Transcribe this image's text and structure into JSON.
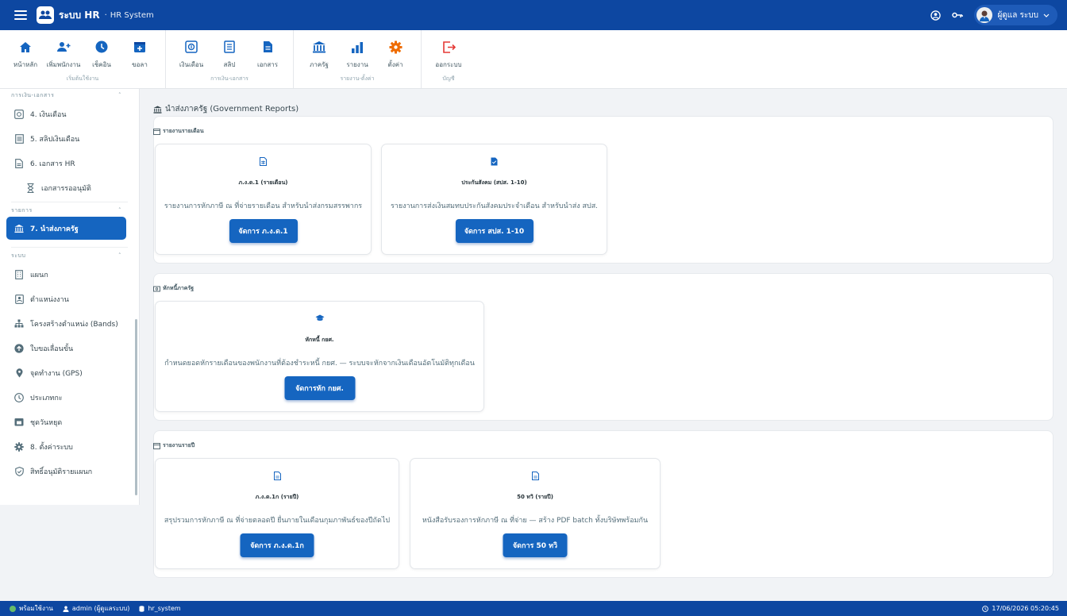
{
  "app": {
    "name": "ระบบ HR",
    "separator": "·",
    "subtitle": "HR System"
  },
  "user": {
    "name": "ผู้ดูแล ระบบ"
  },
  "ribbon": {
    "groups": [
      {
        "label": "เริ่มต้นใช้งาน",
        "buttons": [
          {
            "label": "หน้าหลัก",
            "icon": "home-icon"
          },
          {
            "label": "เพิ่มพนักงาน",
            "icon": "add-user-icon"
          },
          {
            "label": "เช็คอิน",
            "icon": "clock-icon"
          },
          {
            "label": "ขอลา",
            "icon": "calendar-plus-icon"
          }
        ]
      },
      {
        "label": "การเงิน-เอกสาร",
        "buttons": [
          {
            "label": "เงินเดือน",
            "icon": "salary-icon"
          },
          {
            "label": "สลิป",
            "icon": "slip-icon"
          },
          {
            "label": "เอกสาร",
            "icon": "document-icon"
          }
        ]
      },
      {
        "label": "รายงาน-ตั้งค่า",
        "buttons": [
          {
            "label": "ภาครัฐ",
            "icon": "government-icon"
          },
          {
            "label": "รายงาน",
            "icon": "bar-chart-icon"
          },
          {
            "label": "ตั้งค่า",
            "icon": "gear-icon"
          }
        ]
      },
      {
        "label": "บัญชี",
        "buttons": [
          {
            "label": "ออกระบบ",
            "icon": "logout-icon"
          }
        ]
      }
    ]
  },
  "sidebar": {
    "sections": {
      "finance": "การเงิน-เอกสาร",
      "reports": "รายการ",
      "system": "ระบบ"
    },
    "items": [
      {
        "label": "4. เงินเดือน",
        "icon": "salary-icon"
      },
      {
        "label": "5. สลิปเงินเดือน",
        "icon": "slip-icon"
      },
      {
        "label": "6. เอกสาร HR",
        "icon": "document-icon"
      },
      {
        "label": "เอกสารรออนุมัติ",
        "icon": "hourglass-icon"
      },
      {
        "label": "7. นำส่งภาครัฐ",
        "icon": "government-icon"
      },
      {
        "label": "แผนก",
        "icon": "building-icon"
      },
      {
        "label": "ตำแหน่งงาน",
        "icon": "badge-icon"
      },
      {
        "label": "โครงสร้างตำแหน่ง (Bands)",
        "icon": "hierarchy-icon"
      },
      {
        "label": "ใบขอเลื่อนขั้น",
        "icon": "arrow-up-icon"
      },
      {
        "label": "จุดทำงาน (GPS)",
        "icon": "location-pin-icon"
      },
      {
        "label": "ประเภทกะ",
        "icon": "clock-icon"
      },
      {
        "label": "ชุดวันหยุด",
        "icon": "calendar-icon"
      },
      {
        "label": "8. ตั้งค่าระบบ",
        "icon": "gear-icon"
      },
      {
        "label": "สิทธิ์อนุมัติรายแผนก",
        "icon": "shield-icon"
      }
    ]
  },
  "main": {
    "title": "นำส่งภาครัฐ (Government Reports)",
    "sections": [
      {
        "label": "รายงานรายเดือน",
        "cards": [
          {
            "title": "ภ.ง.ด.1 (รายเดือน)",
            "desc": "รายงานการหักภาษี ณ ที่จ่ายรายเดือน สำหรับนำส่งกรมสรรพากร",
            "button": "จัดการ ภ.ง.ด.1"
          },
          {
            "title": "ประกันสังคม (สปส. 1-10)",
            "desc": "รายงานการส่งเงินสมทบประกันสังคมประจำเดือน สำหรับนำส่ง สปส.",
            "button": "จัดการ สปส. 1-10"
          }
        ]
      },
      {
        "label": "หักหนี้ภาครัฐ",
        "cards": [
          {
            "title": "หักหนี้ กยศ.",
            "desc": "กำหนดยอดหักรายเดือนของพนักงานที่ต้องชำระหนี้ กยศ. — ระบบจะหักจากเงินเดือนอัตโนมัติทุกเดือน",
            "button": "จัดการหัก กยศ."
          }
        ]
      },
      {
        "label": "รายงานรายปี",
        "cards": [
          {
            "title": "ภ.ง.ด.1ก (รายปี)",
            "desc": "สรุปรวมการหักภาษี ณ ที่จ่ายตลอดปี ยื่นภายในเดือนกุมภาพันธ์ของปีถัดไป",
            "button": "จัดการ ภ.ง.ด.1ก"
          },
          {
            "title": "50 ทวิ (รายปี)",
            "desc": "หนังสือรับรองการหักภาษี ณ ที่จ่าย — สร้าง PDF batch ทั้งบริษัทพร้อมกัน",
            "button": "จัดการ 50 ทวิ"
          }
        ]
      }
    ]
  },
  "status": {
    "ready": "พร้อมใช้งาน",
    "user": "admin (ผู้ดูแลระบบ)",
    "db": "hr_system",
    "datetime": "17/06/2026 05:20:45"
  },
  "colors": {
    "primary": "#0d47a1",
    "accent": "#1565c0",
    "gear": "#ef6c00",
    "logout": "#e53935"
  }
}
